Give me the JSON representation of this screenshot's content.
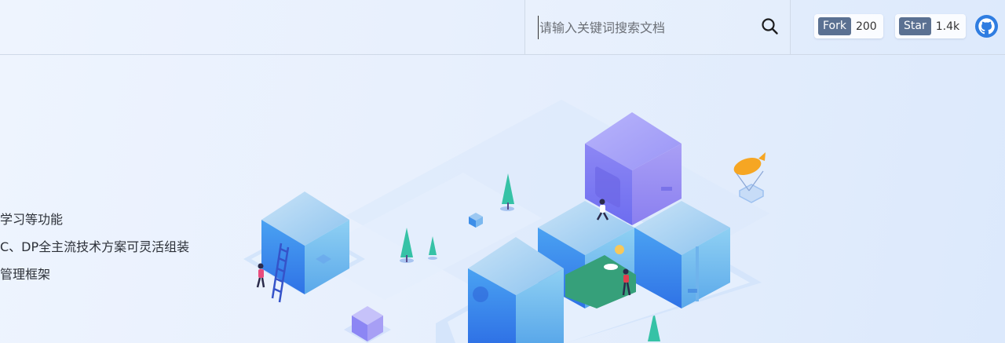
{
  "header": {
    "search": {
      "placeholder": "请输入关键词搜索文档"
    },
    "fork": {
      "label": "Fork",
      "count": "200"
    },
    "star": {
      "label": "Star",
      "count": "1.4k"
    }
  },
  "hero": {
    "features": [
      "学习等功能",
      "C、DP全主流技术方案可灵活组装",
      "管理框架"
    ]
  },
  "colors": {
    "badge_tag": "#5b7192",
    "github": "#2f7de1",
    "cube_blue": "#3c8ef0",
    "cube_purple": "#8c86f4"
  }
}
